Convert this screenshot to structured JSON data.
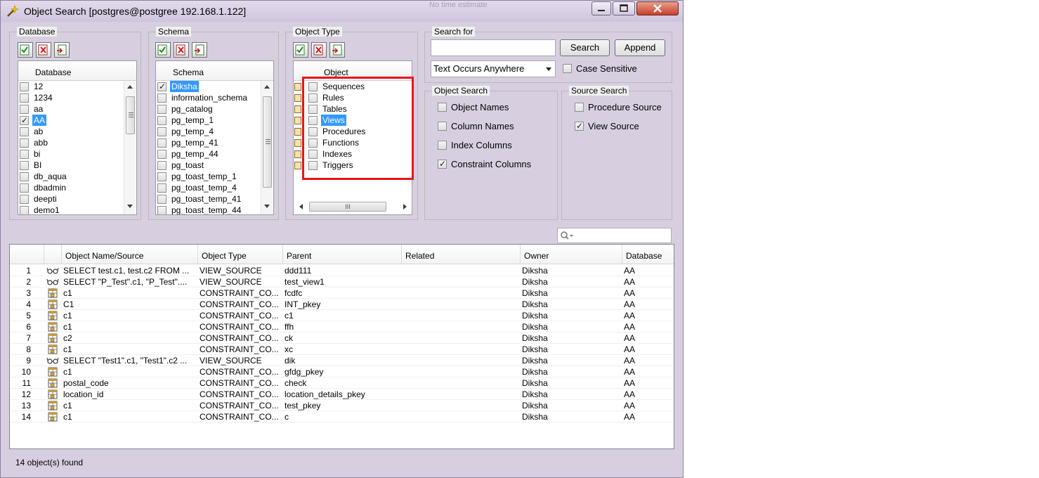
{
  "window": {
    "title": "Object Search [postgres@postgree 192.168.1.122]",
    "faint_overlay_text": "No time estimate"
  },
  "database": {
    "label": "Database",
    "column_header": "Database",
    "items": [
      {
        "name": "12",
        "checked": false,
        "selected": false
      },
      {
        "name": "1234",
        "checked": false,
        "selected": false
      },
      {
        "name": "aa",
        "checked": false,
        "selected": false
      },
      {
        "name": "AA",
        "checked": true,
        "selected": true
      },
      {
        "name": "ab",
        "checked": false,
        "selected": false
      },
      {
        "name": "abb",
        "checked": false,
        "selected": false
      },
      {
        "name": "bi",
        "checked": false,
        "selected": false
      },
      {
        "name": "BI",
        "checked": false,
        "selected": false
      },
      {
        "name": "db_aqua",
        "checked": false,
        "selected": false
      },
      {
        "name": "dbadmin",
        "checked": false,
        "selected": false
      },
      {
        "name": "deepti",
        "checked": false,
        "selected": false
      },
      {
        "name": "demo1",
        "checked": false,
        "selected": false
      }
    ]
  },
  "schema": {
    "label": "Schema",
    "column_header": "Schema",
    "items": [
      {
        "name": "Diksha",
        "checked": true,
        "selected": true
      },
      {
        "name": "information_schema",
        "checked": false,
        "selected": false
      },
      {
        "name": "pg_catalog",
        "checked": false,
        "selected": false
      },
      {
        "name": "pg_temp_1",
        "checked": false,
        "selected": false
      },
      {
        "name": "pg_temp_4",
        "checked": false,
        "selected": false
      },
      {
        "name": "pg_temp_41",
        "checked": false,
        "selected": false
      },
      {
        "name": "pg_temp_44",
        "checked": false,
        "selected": false
      },
      {
        "name": "pg_toast",
        "checked": false,
        "selected": false
      },
      {
        "name": "pg_toast_temp_1",
        "checked": false,
        "selected": false
      },
      {
        "name": "pg_toast_temp_4",
        "checked": false,
        "selected": false
      },
      {
        "name": "pg_toast_temp_41",
        "checked": false,
        "selected": false
      },
      {
        "name": "pg_toast_temp_44",
        "checked": false,
        "selected": false
      }
    ]
  },
  "object_type": {
    "label": "Object Type",
    "column_header": "Object",
    "items": [
      {
        "name": "Sequences",
        "checked": false,
        "selected": false,
        "icon": "sequence-icon"
      },
      {
        "name": "Rules",
        "checked": false,
        "selected": false,
        "icon": "rule-icon"
      },
      {
        "name": "Tables",
        "checked": false,
        "selected": false,
        "icon": "table-icon"
      },
      {
        "name": "Views",
        "checked": false,
        "selected": true,
        "icon": "view-icon"
      },
      {
        "name": "Procedures",
        "checked": false,
        "selected": false,
        "icon": "procedure-icon"
      },
      {
        "name": "Functions",
        "checked": false,
        "selected": false,
        "icon": "function-icon"
      },
      {
        "name": "Indexes",
        "checked": false,
        "selected": false,
        "icon": "index-icon"
      },
      {
        "name": "Triggers",
        "checked": false,
        "selected": false,
        "icon": "trigger-icon"
      }
    ],
    "hscroll_grip": "III"
  },
  "search_for": {
    "label": "Search for",
    "value": "",
    "search_button": "Search",
    "append_button": "Append",
    "match_mode": "Text Occurs Anywhere",
    "case_sensitive_label": "Case Sensitive",
    "case_sensitive": false
  },
  "object_search": {
    "label": "Object Search",
    "options": [
      {
        "label": "Object Names",
        "checked": false
      },
      {
        "label": "Column Names",
        "checked": false
      },
      {
        "label": "Index Columns",
        "checked": false
      },
      {
        "label": "Constraint Columns",
        "checked": true
      }
    ]
  },
  "source_search": {
    "label": "Source Search",
    "options": [
      {
        "label": "Procedure Source",
        "checked": false
      },
      {
        "label": "View Source",
        "checked": true
      }
    ]
  },
  "filter": {
    "placeholder": ""
  },
  "results": {
    "columns": [
      "Object Name/Source",
      "Object Type",
      "Parent",
      "Related",
      "Owner",
      "Database"
    ],
    "rows": [
      {
        "n": "1",
        "icon": "glasses-icon",
        "name": "SELECT test.c1, test.c2 FROM ...",
        "type": "VIEW_SOURCE",
        "parent": "ddd111",
        "related": "",
        "owner": "Diksha",
        "db": "AA"
      },
      {
        "n": "2",
        "icon": "glasses-icon",
        "name": "SELECT \"P_Test\".c1, \"P_Test\"....",
        "type": "VIEW_SOURCE",
        "parent": "test_view1",
        "related": "",
        "owner": "Diksha",
        "db": "AA"
      },
      {
        "n": "3",
        "icon": "constraint-icon",
        "name": "c1",
        "type": "CONSTRAINT_CO...",
        "parent": "fcdfc",
        "related": "",
        "owner": "Diksha",
        "db": "AA"
      },
      {
        "n": "4",
        "icon": "constraint-icon",
        "name": "C1",
        "type": "CONSTRAINT_CO...",
        "parent": "INT_pkey",
        "related": "",
        "owner": "Diksha",
        "db": "AA"
      },
      {
        "n": "5",
        "icon": "constraint-icon",
        "name": "c1",
        "type": "CONSTRAINT_CO...",
        "parent": "c1",
        "related": "",
        "owner": "Diksha",
        "db": "AA"
      },
      {
        "n": "6",
        "icon": "constraint-icon",
        "name": "c1",
        "type": "CONSTRAINT_CO...",
        "parent": "ffh",
        "related": "",
        "owner": "Diksha",
        "db": "AA"
      },
      {
        "n": "7",
        "icon": "constraint-icon",
        "name": "c2",
        "type": "CONSTRAINT_CO...",
        "parent": "ck",
        "related": "",
        "owner": "Diksha",
        "db": "AA"
      },
      {
        "n": "8",
        "icon": "constraint-icon",
        "name": "c1",
        "type": "CONSTRAINT_CO...",
        "parent": "xc",
        "related": "",
        "owner": "Diksha",
        "db": "AA"
      },
      {
        "n": "9",
        "icon": "glasses-icon",
        "name": "SELECT \"Test1\".c1, \"Test1\".c2 ...",
        "type": "VIEW_SOURCE",
        "parent": "dik",
        "related": "",
        "owner": "Diksha",
        "db": "AA"
      },
      {
        "n": "10",
        "icon": "constraint-icon",
        "name": "c1",
        "type": "CONSTRAINT_CO...",
        "parent": "gfdg_pkey",
        "related": "",
        "owner": "Diksha",
        "db": "AA"
      },
      {
        "n": "11",
        "icon": "constraint-icon",
        "name": "postal_code",
        "type": "CONSTRAINT_CO...",
        "parent": "check",
        "related": "",
        "owner": "Diksha",
        "db": "AA"
      },
      {
        "n": "12",
        "icon": "constraint-icon",
        "name": "location_id",
        "type": "CONSTRAINT_CO...",
        "parent": "location_details_pkey",
        "related": "",
        "owner": "Diksha",
        "db": "AA"
      },
      {
        "n": "13",
        "icon": "constraint-icon",
        "name": "c1",
        "type": "CONSTRAINT_CO...",
        "parent": "test_pkey",
        "related": "",
        "owner": "Diksha",
        "db": "AA"
      },
      {
        "n": "14",
        "icon": "constraint-icon",
        "name": "c1",
        "type": "CONSTRAINT_CO...",
        "parent": "c",
        "related": "",
        "owner": "Diksha",
        "db": "AA"
      }
    ]
  },
  "status": {
    "text": "14 object(s) found"
  },
  "colors": {
    "selection": "#3399ff",
    "highlight_box": "#e8141c",
    "window_frame": "#d7cfe0"
  }
}
